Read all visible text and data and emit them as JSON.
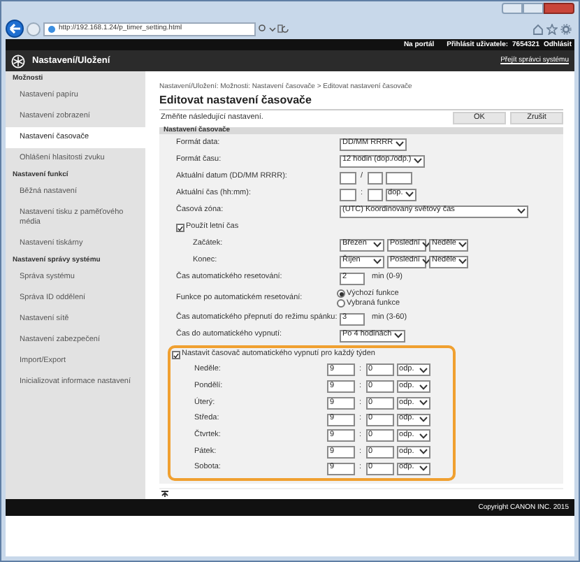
{
  "browser": {
    "url": "http://192.168.1.24/p_timer_setting.html"
  },
  "top_bar": {
    "portal_link": "Na portál",
    "user_label": "Přihlásit uživatele:",
    "user_id": "7654321",
    "logout": "Odhlásit"
  },
  "app_bar": {
    "title": "Nastavení/Uložení",
    "admin_link": "Přejít správci systému"
  },
  "sidebar": {
    "sections": [
      {
        "title": "Možnosti",
        "items": [
          {
            "label": "Nastavení papíru",
            "selected": false
          },
          {
            "label": "Nastavení zobrazení",
            "selected": false
          },
          {
            "label": "Nastavení časovače",
            "selected": true
          },
          {
            "label": "Ohlášení hlasitosti zvuku",
            "selected": false
          }
        ]
      },
      {
        "title": "Nastavení funkcí",
        "items": [
          {
            "label": "Běžná nastavení",
            "selected": false
          },
          {
            "label": "Nastavení tisku z paměťového média",
            "selected": false
          },
          {
            "label": "Nastavení tiskárny",
            "selected": false
          }
        ]
      },
      {
        "title": "Nastavení správy systému",
        "items": [
          {
            "label": "Správa systému",
            "selected": false
          },
          {
            "label": "Správa ID oddělení",
            "selected": false
          },
          {
            "label": "Nastavení sítě",
            "selected": false
          },
          {
            "label": "Nastavení zabezpečení",
            "selected": false
          },
          {
            "label": "Import/Export",
            "selected": false
          },
          {
            "label": "Inicializovat informace nastavení",
            "selected": false
          }
        ]
      }
    ]
  },
  "breadcrumb": "Nastavení/Uložení: Možnosti: Nastavení časovače > Editovat nastavení časovače",
  "title": "Editovat nastavení časovače",
  "instruction": "Změňte následující nastavení.",
  "buttons": [
    "OK",
    "Zrušit"
  ],
  "section": {
    "title": "Nastavení časovače",
    "fields": [
      {
        "kind": "select",
        "label": "Formát data:",
        "value": "DD/MM RRRR"
      },
      {
        "kind": "select",
        "label": "Formát času:",
        "value": "12 hodin (dop./odp.)"
      },
      {
        "kind": "date",
        "label": "Aktuální datum (DD/MM RRRR):",
        "separator": "/"
      },
      {
        "kind": "time",
        "label": "Aktuální čas (hh:mm):",
        "separator": ":",
        "period": "dop."
      },
      {
        "kind": "wide_select",
        "label": "Časová zóna:",
        "value": "(UTC) Koordinovaný světový čas"
      },
      {
        "kind": "checkbox",
        "label": "Použít letní čas",
        "checked": true
      },
      {
        "kind": "sub_selects",
        "label": "Začátek:",
        "values": [
          "Březen",
          "Poslední",
          "Neděle"
        ]
      },
      {
        "kind": "sub_selects",
        "label": "Konec:",
        "values": [
          "Říjen",
          "Poslední",
          "Neděle"
        ]
      },
      {
        "kind": "number",
        "label": "Čas automatického resetování:",
        "value": "2",
        "unit": "min (0-9)"
      },
      {
        "kind": "radio",
        "label": "Funkce po automatickém resetování:",
        "options": [
          {
            "label": "Výchozí funkce",
            "selected": true
          },
          {
            "label": "Vybraná funkce",
            "selected": false
          }
        ]
      },
      {
        "kind": "number",
        "label": "Čas automatického přepnutí do režimu spánku:",
        "value": "3",
        "unit": "min (3-60)"
      },
      {
        "kind": "select",
        "label": "Čas do automatického vypnutí:",
        "value": "Po 4 hodinách"
      }
    ]
  },
  "weekly": {
    "label": "Nastavit časovač automatického vypnutí pro každý týden",
    "checked": true,
    "days": [
      {
        "label": "Neděle:",
        "hour": "9",
        "separator": ":",
        "minute": "0",
        "period": "odp."
      },
      {
        "label": "Pondělí:",
        "hour": "9",
        "separator": ":",
        "minute": "0",
        "period": "odp."
      },
      {
        "label": "Úterý:",
        "hour": "9",
        "separator": ":",
        "minute": "0",
        "period": "odp."
      },
      {
        "label": "Středa:",
        "hour": "9",
        "separator": ":",
        "minute": "0",
        "period": "odp."
      },
      {
        "label": "Čtvrtek:",
        "hour": "9",
        "separator": ":",
        "minute": "0",
        "period": "odp."
      },
      {
        "label": "Pátek:",
        "hour": "9",
        "separator": ":",
        "minute": "0",
        "period": "odp."
      },
      {
        "label": "Sobota:",
        "hour": "9",
        "separator": ":",
        "minute": "0",
        "period": "odp."
      }
    ]
  },
  "footer": {
    "copyright": "Copyright CANON INC. 2015"
  }
}
